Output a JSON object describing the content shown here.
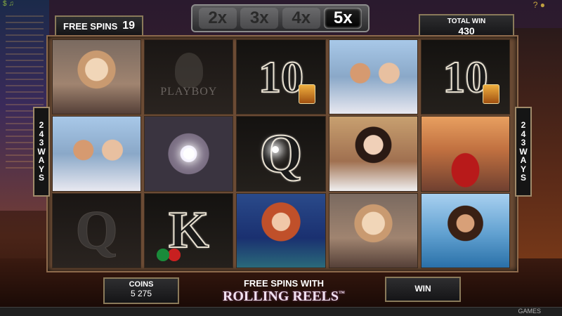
{
  "hud": {
    "free_spins_label": "FREE SPINS",
    "free_spins_value": "19",
    "total_win_label": "TOTAL WIN",
    "total_win_value": "430",
    "ways_digits": [
      "2",
      "4",
      "3"
    ],
    "ways_word_letters": [
      "W",
      "A",
      "Y",
      "S"
    ]
  },
  "multipliers": {
    "items": [
      "2x",
      "3x",
      "4x",
      "5x"
    ],
    "active": "5x"
  },
  "reels": [
    [
      "woman-blonde",
      "couple-yacht",
      "q-faded"
    ],
    [
      "playboy-logo-faded",
      "sparkle",
      "k-chips"
    ],
    [
      "ten-glass",
      "q-card",
      "woman-red"
    ],
    [
      "couple-yacht",
      "woman-brunette",
      "woman-blonde"
    ],
    [
      "ten-glass",
      "woman-car",
      "woman-beach"
    ]
  ],
  "symbols": {
    "ten": "10",
    "queen": "Q",
    "king": "K",
    "logo_text": "PLAYBOY"
  },
  "bottom": {
    "coins_label": "COINS",
    "coins_value": "5 275",
    "promo_line1": "FREE SPINS WITH",
    "promo_line2": "ROLLING REELS",
    "promo_tm": "™",
    "win_label": "WIN",
    "games_label": "GAMES"
  },
  "colors": {
    "panel_border": "#8a7a5a",
    "active_multiplier": "#000000",
    "frame": "#6b4b34"
  }
}
